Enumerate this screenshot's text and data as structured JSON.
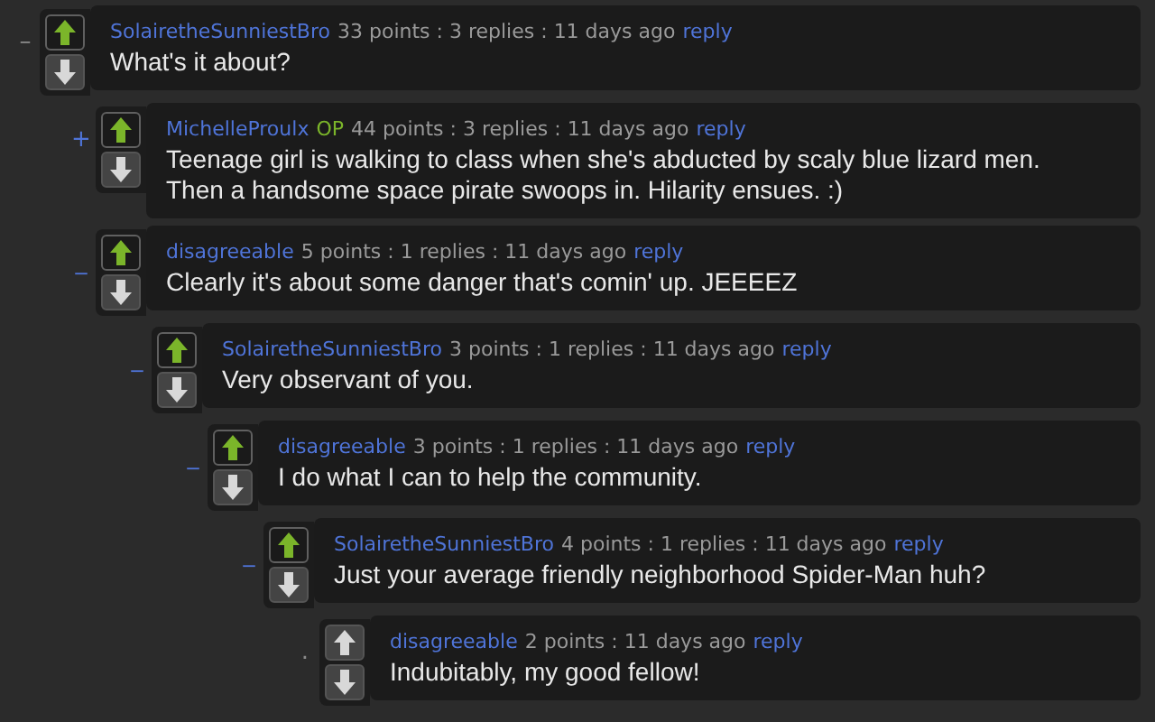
{
  "comments": [
    {
      "toggle": "–",
      "upvoted": true,
      "author": "SolairetheSunniestBro",
      "op": false,
      "meta": "33 points : 3 replies : 11 days ago",
      "reply": "reply",
      "lines": [
        "What's it about?"
      ],
      "children": [
        {
          "toggle": "+",
          "upvoted": true,
          "author": "MichelleProulx",
          "op": true,
          "op_label": "OP",
          "meta": "44 points : 3 replies : 11 days ago",
          "reply": "reply",
          "lines": [
            "Teenage girl is walking to class when she's abducted by scaly blue lizard men.",
            "Then a handsome space pirate swoops in. Hilarity ensues. :)"
          ]
        },
        {
          "toggle": "_",
          "upvoted": true,
          "author": "disagreeable",
          "op": false,
          "meta": "5 points : 1 replies : 11 days ago",
          "reply": "reply",
          "lines": [
            "Clearly it's about some danger that's comin' up. JEEEEZ"
          ],
          "children": [
            {
              "toggle": "_",
              "upvoted": true,
              "author": "SolairetheSunniestBro",
              "op": false,
              "meta": "3 points : 1 replies : 11 days ago",
              "reply": "reply",
              "lines": [
                "Very observant of you."
              ],
              "children": [
                {
                  "toggle": "_",
                  "upvoted": true,
                  "author": "disagreeable",
                  "op": false,
                  "meta": "3 points : 1 replies : 11 days ago",
                  "reply": "reply",
                  "lines": [
                    "I do what I can to help the community."
                  ],
                  "children": [
                    {
                      "toggle": "_",
                      "upvoted": true,
                      "author": "SolairetheSunniestBro",
                      "op": false,
                      "meta": "4 points : 1 replies : 11 days ago",
                      "reply": "reply",
                      "lines": [
                        "Just your average friendly neighborhood Spider-Man huh?"
                      ],
                      "children": [
                        {
                          "toggle": ".",
                          "upvoted": false,
                          "author": "disagreeable",
                          "op": false,
                          "meta": "2 points : 11 days ago",
                          "reply": "reply",
                          "lines": [
                            "Indubitably, my good fellow!"
                          ]
                        }
                      ]
                    }
                  ]
                }
              ]
            }
          ]
        }
      ]
    }
  ]
}
